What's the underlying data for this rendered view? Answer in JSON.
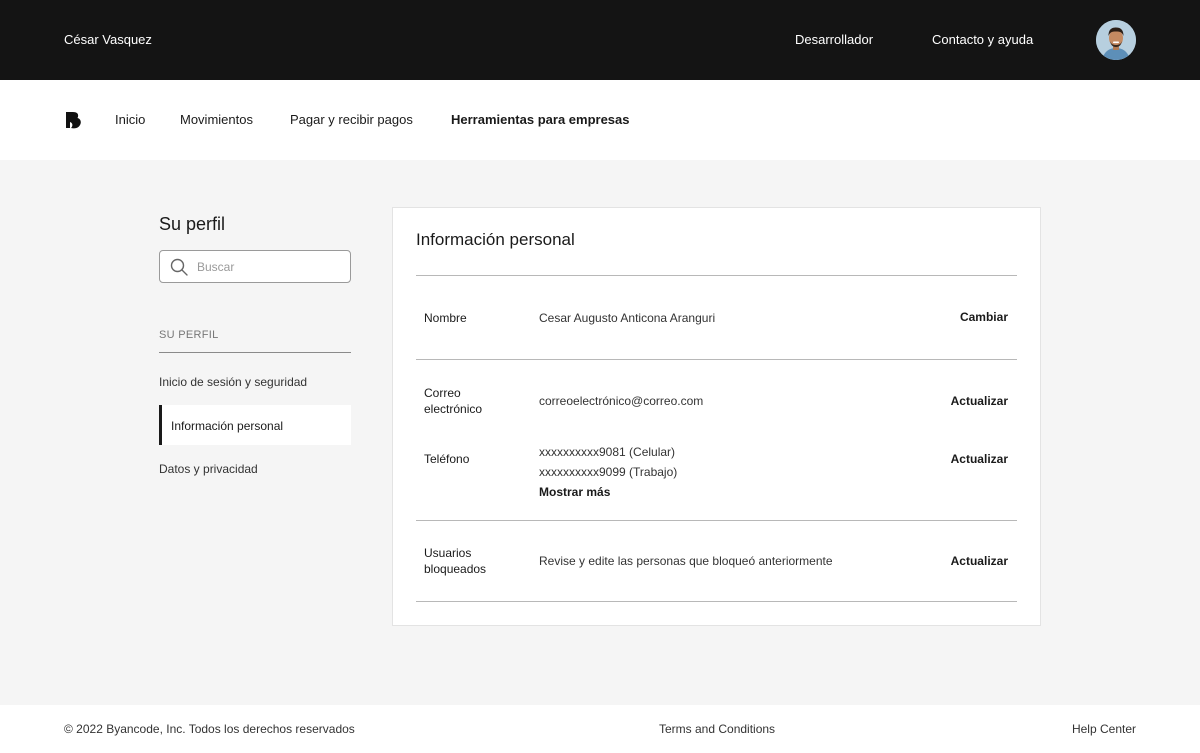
{
  "topbar": {
    "user_name": "César Vasquez",
    "developer_link": "Desarrollador",
    "help_link": "Contacto y ayuda"
  },
  "nav": {
    "items": [
      {
        "label": "Inicio"
      },
      {
        "label": "Movimientos"
      },
      {
        "label": "Pagar y recibir pagos"
      },
      {
        "label": "Herramientas para empresas"
      }
    ]
  },
  "sidebar": {
    "title": "Su perfil",
    "search_placeholder": "Buscar",
    "section_label": "SU PERFIL",
    "items": [
      {
        "label": "Inicio de sesión y seguridad"
      },
      {
        "label": "Información personal"
      },
      {
        "label": "Datos y privacidad"
      }
    ]
  },
  "card": {
    "title": "Información personal",
    "rows": {
      "name": {
        "label": "Nombre",
        "value": "Cesar Augusto Anticona Aranguri",
        "action": "Cambiar"
      },
      "email": {
        "label_line1": "Correo",
        "label_line2": "electrónico",
        "value": "correoelectrónico@correo.com",
        "action": "Actualizar"
      },
      "phone": {
        "label": "Teléfono",
        "value1": "xxxxxxxxxx9081 (Celular)",
        "value2": "xxxxxxxxxx9099 (Trabajo)",
        "more": "Mostrar más",
        "action": "Actualizar"
      },
      "blocked": {
        "label_line1": "Usuarios",
        "label_line2": "bloqueados",
        "value": "Revise y edite las personas que bloqueó anteriormente",
        "action": "Actualizar"
      }
    }
  },
  "footer": {
    "copyright": "© 2022 Byancode, Inc. Todos los derechos reservados",
    "terms": "Terms and Conditions",
    "help_center": "Help Center"
  },
  "colors": {
    "topbar_bg": "#141414",
    "page_bg": "#f5f5f5",
    "accent": "#1a1a1a"
  }
}
